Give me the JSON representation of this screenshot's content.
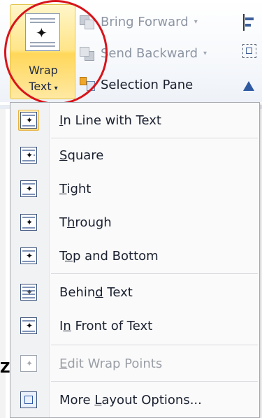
{
  "ribbon": {
    "wrap_text": {
      "line1": "Wrap",
      "line2": "Text",
      "arrow": "▾"
    },
    "bring_forward": {
      "label": "Bring Forward",
      "arrow": "▾",
      "icon": "bring-forward-icon"
    },
    "send_backward": {
      "label": "Send Backward",
      "arrow": "▾",
      "icon": "send-backward-icon"
    },
    "selection_pane": {
      "label": "Selection Pane",
      "icon": "selection-pane-icon"
    },
    "right_icons": [
      "align-icon",
      "group-icon",
      "rotate-icon"
    ]
  },
  "menu": {
    "items": [
      {
        "label": "In Line with Text",
        "access_key": "I",
        "icon": "inline-wrap-icon",
        "selected": true,
        "enabled": true
      },
      {
        "label": "Square",
        "access_key": "S",
        "icon": "square-wrap-icon",
        "selected": false,
        "enabled": true
      },
      {
        "label": "Tight",
        "access_key": "T",
        "icon": "tight-wrap-icon",
        "selected": false,
        "enabled": true
      },
      {
        "label": "Through",
        "access_key": "h",
        "icon": "through-wrap-icon",
        "selected": false,
        "enabled": true
      },
      {
        "label": "Top and Bottom",
        "access_key": "o",
        "icon": "top-bottom-wrap-icon",
        "selected": false,
        "enabled": true
      },
      {
        "label": "Behind Text",
        "access_key": "d",
        "icon": "behind-text-icon",
        "selected": false,
        "enabled": true
      },
      {
        "label": "In Front of Text",
        "access_key": "n",
        "icon": "in-front-text-icon",
        "selected": false,
        "enabled": true
      },
      {
        "label": "Edit Wrap Points",
        "access_key": "E",
        "icon": "edit-wrap-points-icon",
        "selected": false,
        "enabled": false
      },
      {
        "label": "More Layout Options...",
        "access_key": "L",
        "icon": "layout-options-icon",
        "selected": false,
        "enabled": true
      }
    ]
  },
  "background": {
    "partial_text": "Z"
  },
  "colors": {
    "accent_highlight": "#ffe58a",
    "annotation_circle": "#d8141b",
    "menu_border": "#a7abb0"
  }
}
